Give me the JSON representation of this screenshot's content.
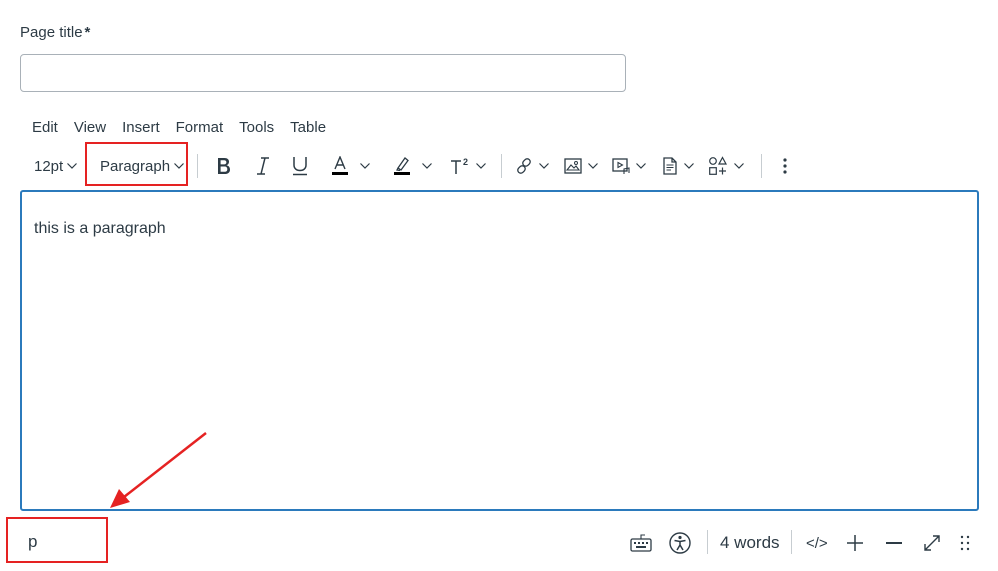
{
  "page_title": {
    "label": "Page title",
    "required_marker": "*",
    "value": ""
  },
  "menubar": {
    "items": [
      "Edit",
      "View",
      "Insert",
      "Format",
      "Tools",
      "Table"
    ]
  },
  "toolbar": {
    "font_size": "12pt",
    "block_format": "Paragraph",
    "buttons": [
      "bold-icon",
      "italic-icon",
      "underline-icon",
      "text-color-icon",
      "highlight-color-icon",
      "superscript-icon",
      "link-icon",
      "image-icon",
      "media-icon",
      "document-icon",
      "apps-icon",
      "more-vertical-icon"
    ]
  },
  "editor": {
    "content": "this is a paragraph"
  },
  "statusbar": {
    "element_path": "p",
    "word_count": "4 words",
    "html_toggle": "</>"
  },
  "annotation": {
    "color": "#e52222"
  },
  "colors": {
    "focus_border": "#2b7abc",
    "text": "#2d3b45",
    "input_border": "#a9b1b8"
  }
}
